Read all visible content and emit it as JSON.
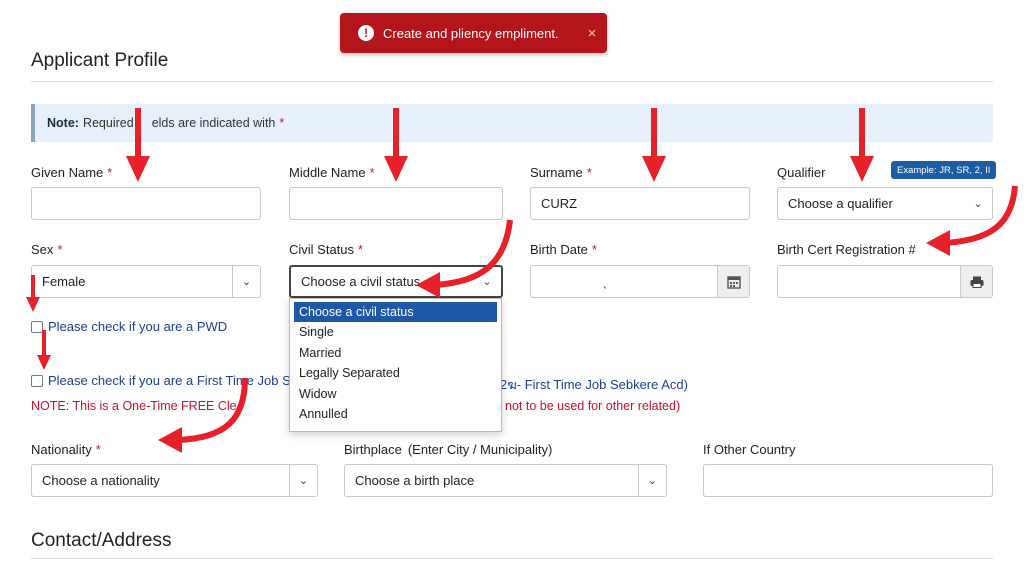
{
  "toast": {
    "message": "Create and pliency empliment.",
    "icon": "alert-circle-icon",
    "close": "×"
  },
  "profile": {
    "title": "Applicant Profile"
  },
  "note": {
    "bold": "Note:",
    "text": "Required",
    "text_tail": "elds are indicated with",
    "asterisk": "*"
  },
  "fields": {
    "given_name": {
      "label": "Given Name",
      "required": "*",
      "value": ""
    },
    "middle_name": {
      "label": "Middle Name",
      "required": "*",
      "value": ""
    },
    "surname": {
      "label": "Surname",
      "required": "*",
      "value": "CURZ"
    },
    "qualifier": {
      "label": "Qualifier",
      "value": "Choose a qualifier",
      "hint": "Example: JR, SR, 2, II"
    },
    "sex": {
      "label": "Sex",
      "required": "*",
      "value": "Female"
    },
    "civil_status": {
      "label": "Civil Status",
      "required": "*",
      "value": "Choose a civil status",
      "options": [
        "Choose a civil status",
        "Single",
        "Married",
        "Legally Separated",
        "Widow",
        "Annulled"
      ]
    },
    "birth_date": {
      "label": "Birth Date",
      "required": "*",
      "value": "ˎ"
    },
    "birth_cert": {
      "label": "Birth Cert Registration #",
      "value": ""
    },
    "nationality": {
      "label": "Nationality",
      "required": "*",
      "value": "Choose a nationality"
    },
    "birthplace": {
      "label": "Birthplace",
      "sub": "(Enter City / Municipality)",
      "value": "Choose a birth place"
    },
    "other_country": {
      "label": "If Other Country",
      "value": ""
    }
  },
  "checks": {
    "pwd": "Please check if you are a PWD",
    "first_time": "Please check if you are a First Time Job S",
    "first_time_tail": "l2ฆ- First Time Job Sebkere Acd)",
    "note_left": "NOTE: This is a One-Time FREE Cle",
    "note_right": "not to be used for other related)"
  },
  "contact": {
    "title": "Contact/Address"
  },
  "colors": {
    "accent": "#1d58a8",
    "danger": "#c8102e",
    "toast": "#b3151b",
    "arrow": "#e8202a"
  }
}
